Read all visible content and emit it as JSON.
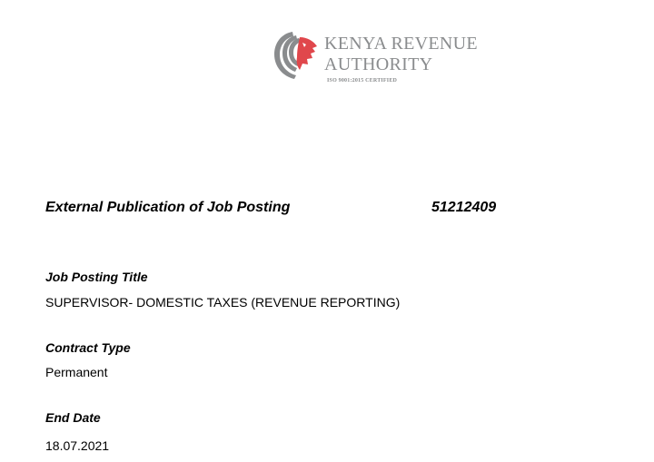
{
  "logo": {
    "line1": "KENYA REVENUE",
    "line2": "AUTHORITY",
    "certification": "ISO 9001:2015 CERTIFIED"
  },
  "posting": {
    "heading": "External Publication of Job Posting",
    "number": "51212409"
  },
  "fields": {
    "title_label": "Job Posting Title",
    "title_value": "SUPERVISOR- DOMESTIC TAXES (REVENUE REPORTING)",
    "contract_label": "Contract Type",
    "contract_value": "Permanent",
    "end_date_label": "End Date",
    "end_date_value": "18.07.2021"
  }
}
